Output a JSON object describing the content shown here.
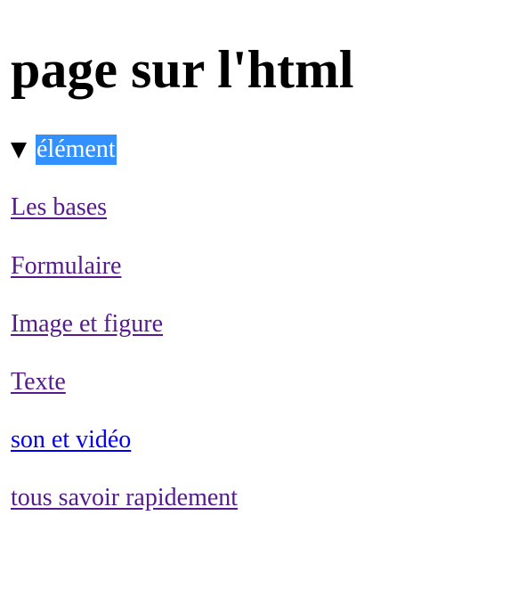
{
  "page": {
    "title": "page sur l'html"
  },
  "details": {
    "summary_label": "élément",
    "open": true
  },
  "links": [
    {
      "label": "Les bases",
      "visited": true,
      "color": "#551a8b"
    },
    {
      "label": "Formulaire",
      "visited": true,
      "color": "#551a8b"
    },
    {
      "label": "Image et figure",
      "visited": true,
      "color": "#551a8b"
    },
    {
      "label": "Texte",
      "visited": true,
      "color": "#551a8b"
    },
    {
      "label": "son et vidéo",
      "visited": false,
      "color": "#0000ee"
    },
    {
      "label": "tous savoir rapidement",
      "visited": true,
      "color": "#551a8b"
    }
  ],
  "colors": {
    "selection_highlight": "#3390ff"
  }
}
